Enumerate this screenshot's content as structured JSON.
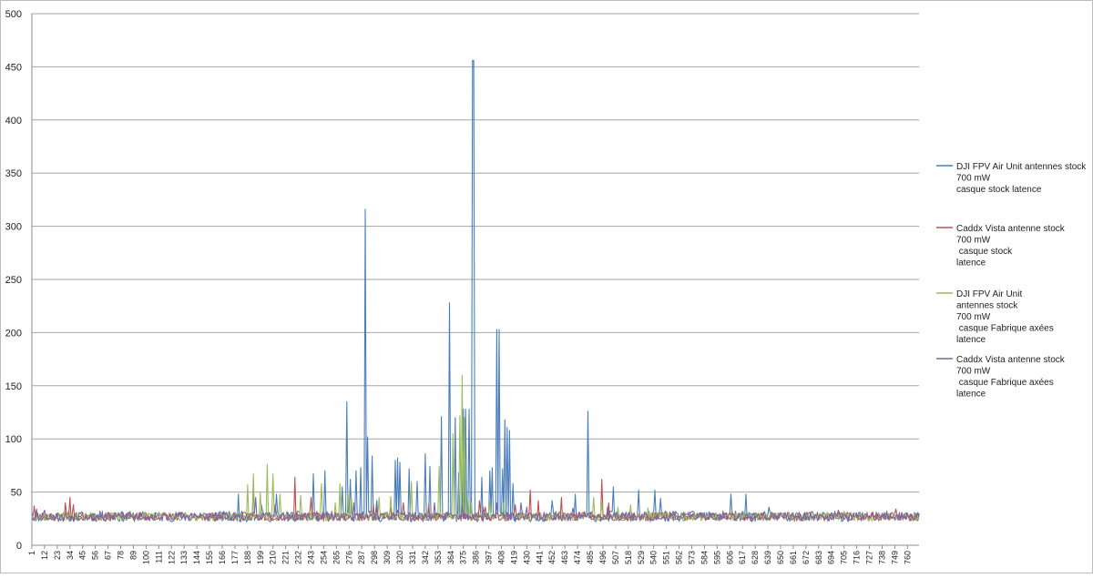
{
  "chart_data": {
    "type": "line",
    "title": "",
    "xlabel": "",
    "ylabel": "",
    "ylim": [
      0,
      500
    ],
    "y_ticks": [
      0,
      50,
      100,
      150,
      200,
      250,
      300,
      350,
      400,
      450,
      500
    ],
    "x_range": [
      1,
      770
    ],
    "x_ticks": [
      1,
      12,
      23,
      34,
      45,
      56,
      67,
      78,
      89,
      100,
      111,
      122,
      133,
      144,
      155,
      166,
      177,
      188,
      199,
      210,
      221,
      232,
      243,
      254,
      265,
      276,
      287,
      298,
      309,
      320,
      331,
      342,
      353,
      364,
      375,
      386,
      397,
      408,
      419,
      430,
      441,
      452,
      463,
      474,
      485,
      496,
      507,
      518,
      529,
      540,
      551,
      562,
      573,
      584,
      595,
      606,
      617,
      628,
      639,
      650,
      661,
      672,
      683,
      694,
      705,
      716,
      727,
      738,
      749,
      760
    ],
    "grid": "horizontal",
    "legend_position": "right",
    "series": [
      {
        "name": "DJI FPV Air Unit antennes stock\n700 mW\ncasque stock latence",
        "color": "#4a7ebb",
        "baseline": 27,
        "noise": 5,
        "seed": 11,
        "peaks": [
          [
            1,
            31
          ],
          [
            180,
            48
          ],
          [
            193,
            57
          ],
          [
            200,
            38
          ],
          [
            213,
            48
          ],
          [
            245,
            67
          ],
          [
            255,
            70
          ],
          [
            270,
            55
          ],
          [
            274,
            135
          ],
          [
            277,
            62
          ],
          [
            282,
            70
          ],
          [
            286,
            73
          ],
          [
            290,
            316
          ],
          [
            292,
            102
          ],
          [
            296,
            84
          ],
          [
            300,
            42
          ],
          [
            316,
            80
          ],
          [
            318,
            82
          ],
          [
            320,
            78
          ],
          [
            328,
            72
          ],
          [
            335,
            60
          ],
          [
            342,
            86
          ],
          [
            346,
            74
          ],
          [
            356,
            121
          ],
          [
            363,
            228
          ],
          [
            368,
            120
          ],
          [
            371,
            68
          ],
          [
            375,
            128
          ],
          [
            377,
            128
          ],
          [
            380,
            128
          ],
          [
            383,
            456
          ],
          [
            384,
            456
          ],
          [
            386,
            30
          ],
          [
            391,
            64
          ],
          [
            398,
            70
          ],
          [
            400,
            73
          ],
          [
            404,
            203
          ],
          [
            406,
            203
          ],
          [
            409,
            72
          ],
          [
            411,
            118
          ],
          [
            413,
            111
          ],
          [
            415,
            108
          ],
          [
            418,
            58
          ],
          [
            452,
            42
          ],
          [
            472,
            48
          ],
          [
            483,
            126
          ],
          [
            505,
            55
          ],
          [
            527,
            52
          ],
          [
            541,
            52
          ],
          [
            546,
            44
          ],
          [
            607,
            48
          ],
          [
            620,
            48
          ],
          [
            640,
            36
          ]
        ]
      },
      {
        "name": "Caddx Vista antenne stock\n700 mW\n casque stock\nlatence",
        "color": "#c0504d",
        "baseline": 27,
        "noise": 4,
        "seed": 23,
        "peaks": [
          [
            3,
            37
          ],
          [
            30,
            40
          ],
          [
            34,
            45
          ],
          [
            37,
            38
          ],
          [
            229,
            64
          ],
          [
            243,
            45
          ],
          [
            297,
            38
          ],
          [
            312,
            35
          ],
          [
            323,
            40
          ],
          [
            345,
            38
          ],
          [
            389,
            42
          ],
          [
            394,
            36
          ],
          [
            420,
            38
          ],
          [
            433,
            52
          ],
          [
            440,
            42
          ],
          [
            460,
            45
          ],
          [
            495,
            62
          ],
          [
            501,
            40
          ],
          [
            550,
            32
          ],
          [
            700,
            32
          ],
          [
            750,
            34
          ],
          [
            770,
            30
          ]
        ]
      },
      {
        "name": "DJI FPV Air Unit\nantennes stock\n700 mW\n casque Fabrique axées\nlatence",
        "color": "#9bbb59",
        "baseline": 27,
        "noise": 4,
        "seed": 37,
        "peaks": [
          [
            188,
            57
          ],
          [
            193,
            67
          ],
          [
            199,
            50
          ],
          [
            205,
            76
          ],
          [
            210,
            67
          ],
          [
            216,
            48
          ],
          [
            234,
            47
          ],
          [
            252,
            58
          ],
          [
            264,
            40
          ],
          [
            268,
            58
          ],
          [
            275,
            50
          ],
          [
            278,
            45
          ],
          [
            302,
            45
          ],
          [
            312,
            46
          ],
          [
            330,
            60
          ],
          [
            354,
            74
          ],
          [
            366,
            105
          ],
          [
            372,
            122
          ],
          [
            374,
            160
          ],
          [
            376,
            120
          ],
          [
            379,
            45
          ],
          [
            382,
            40
          ],
          [
            398,
            42
          ],
          [
            410,
            40
          ],
          [
            488,
            45
          ],
          [
            495,
            40
          ],
          [
            509,
            36
          ],
          [
            520,
            38
          ],
          [
            535,
            35
          ]
        ]
      },
      {
        "name": "Caddx Vista antenne stock\n700 mW\n casque Fabrique axées\nlatence",
        "color": "#8064a2",
        "baseline": 27,
        "noise": 4,
        "seed": 53,
        "peaks": [
          [
            5,
            34
          ],
          [
            12,
            33
          ],
          [
            60,
            32
          ],
          [
            195,
            45
          ],
          [
            212,
            38
          ],
          [
            280,
            40
          ],
          [
            300,
            36
          ],
          [
            318,
            33
          ],
          [
            350,
            40
          ],
          [
            374,
            38
          ],
          [
            392,
            36
          ],
          [
            404,
            40
          ],
          [
            425,
            40
          ],
          [
            430,
            36
          ],
          [
            470,
            35
          ],
          [
            500,
            36
          ],
          [
            600,
            32
          ],
          [
            700,
            33
          ],
          [
            742,
            32
          ]
        ]
      }
    ]
  }
}
